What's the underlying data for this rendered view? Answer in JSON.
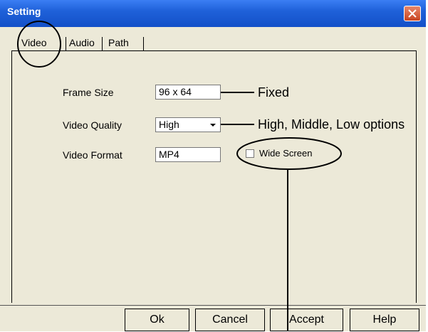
{
  "window": {
    "title": "Setting"
  },
  "tabs": [
    {
      "label": "Video",
      "selected": true
    },
    {
      "label": "Audio",
      "selected": false
    },
    {
      "label": "Path",
      "selected": false
    }
  ],
  "fields": {
    "frame_size": {
      "label": "Frame Size",
      "value": "96 x 64"
    },
    "video_quality": {
      "label": "Video Quality",
      "value": "High"
    },
    "video_format": {
      "label": "Video Format",
      "value": "MP4"
    },
    "wide_screen": {
      "label": "Wide Screen",
      "checked": false
    }
  },
  "annotations": {
    "frame_size_note": "Fixed",
    "video_quality_note": "High, Middle, Low options"
  },
  "buttons": {
    "ok": "Ok",
    "cancel": "Cancel",
    "accept": "Accept",
    "help": "Help"
  },
  "colors": {
    "titlebar": "#1f61d9",
    "window_bg": "#ece9d8",
    "close_button": "#d55a34"
  }
}
